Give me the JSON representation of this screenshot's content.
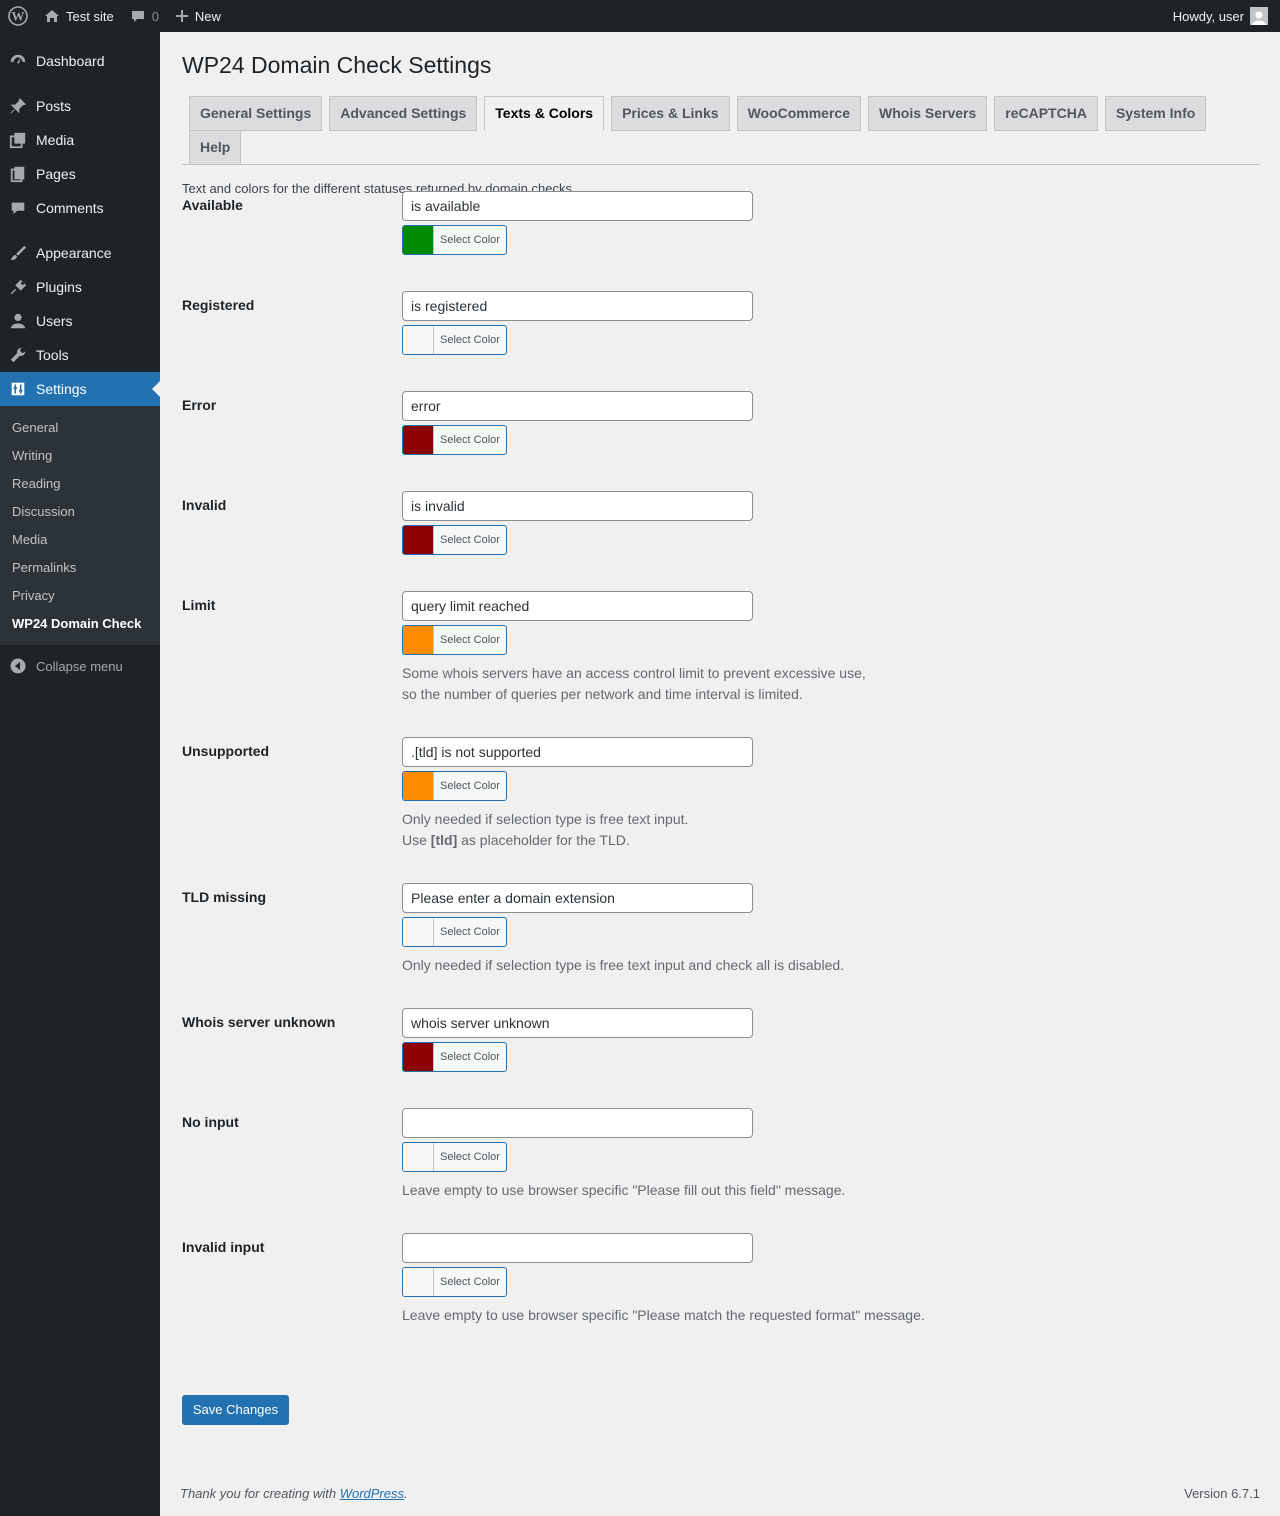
{
  "adminbar": {
    "site_name": "Test site",
    "comments_count": "0",
    "new_label": "New",
    "howdy": "Howdy, user"
  },
  "menu": {
    "items": [
      {
        "label": "Dashboard",
        "icon": "dashboard-icon"
      },
      {
        "label": "Posts",
        "icon": "pin-icon"
      },
      {
        "label": "Media",
        "icon": "media-icon"
      },
      {
        "label": "Pages",
        "icon": "pages-icon"
      },
      {
        "label": "Comments",
        "icon": "comment-icon"
      },
      {
        "label": "Appearance",
        "icon": "brush-icon"
      },
      {
        "label": "Plugins",
        "icon": "plug-icon"
      },
      {
        "label": "Users",
        "icon": "user-icon"
      },
      {
        "label": "Tools",
        "icon": "wrench-icon"
      },
      {
        "label": "Settings",
        "icon": "settings-icon"
      }
    ],
    "submenu": [
      "General",
      "Writing",
      "Reading",
      "Discussion",
      "Media",
      "Permalinks",
      "Privacy",
      "WP24 Domain Check"
    ],
    "collapse": "Collapse menu"
  },
  "page": {
    "title": "WP24 Domain Check Settings",
    "tabs": [
      "General Settings",
      "Advanced Settings",
      "Texts & Colors",
      "Prices & Links",
      "WooCommerce",
      "Whois Servers",
      "reCAPTCHA",
      "System Info",
      "Help"
    ],
    "active_tab": "Texts & Colors",
    "intro": "Text and colors for the different statuses returned by domain checks.",
    "select_color_label": "Select Color",
    "save_label": "Save Changes"
  },
  "fields": [
    {
      "label": "Available",
      "value": "is available",
      "color": "#008a00"
    },
    {
      "label": "Registered",
      "value": "is registered",
      "color": "#f6f7f7"
    },
    {
      "label": "Error",
      "value": "error",
      "color": "#8b0000"
    },
    {
      "label": "Invalid",
      "value": "is invalid",
      "color": "#8b0000"
    },
    {
      "label": "Limit",
      "value": "query limit reached",
      "color": "#ff8c00",
      "desc": [
        "Some whois servers have an access control limit to prevent excessive use,",
        "so the number of queries per network and time interval is limited."
      ]
    },
    {
      "label": "Unsupported",
      "value": ".[tld] is not supported",
      "color": "#ff8c00",
      "desc": [
        "Only needed if selection type is free text input."
      ],
      "desc_tld": {
        "pre": "Use ",
        "code": "[tld]",
        "post": " as placeholder for the TLD."
      }
    },
    {
      "label": "TLD missing",
      "value": "Please enter a domain extension",
      "color": "#f6f7f7",
      "desc": [
        "Only needed if selection type is free text input and check all is disabled."
      ]
    },
    {
      "label": "Whois server unknown",
      "value": "whois server unknown",
      "color": "#8b0000"
    },
    {
      "label": "No input",
      "value": "",
      "color": "#f6f7f7",
      "desc": [
        "Leave empty to use browser specific \"Please fill out this field\" message."
      ]
    },
    {
      "label": "Invalid input",
      "value": "",
      "color": "#f6f7f7",
      "desc": [
        "Leave empty to use browser specific \"Please match the requested format\" message."
      ]
    }
  ],
  "footer": {
    "thanks_pre": "Thank you for creating with ",
    "thanks_link": "WordPress",
    "thanks_post": ".",
    "version": "Version 6.7.1"
  }
}
